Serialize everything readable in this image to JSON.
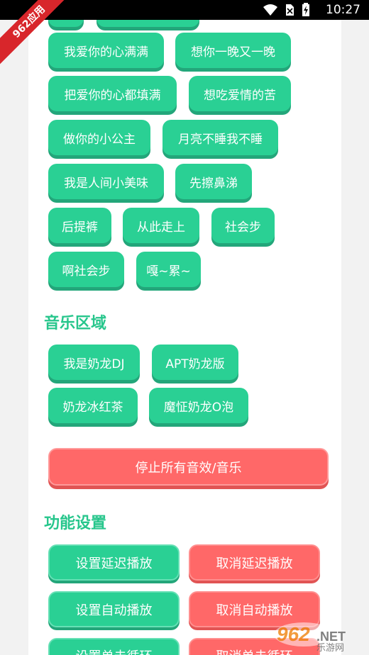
{
  "status": {
    "time": "10:27"
  },
  "badge": "962应用",
  "effect_buttons": [
    "我爱你的心满满",
    "想你一晚又一晚",
    "把爱你的心都填满",
    "想吃爱情的苦",
    "做你的小公主",
    "月亮不睡我不睡",
    "我是人间小美味",
    "先擦鼻涕",
    "后提裤",
    "从此走上",
    "社会步",
    "啊社会步",
    "嘎~累~"
  ],
  "music": {
    "title": "音乐区域",
    "buttons": [
      "我是奶龙DJ",
      "APT奶龙版",
      "奶龙冰红茶",
      "魔怔奶龙O泡"
    ]
  },
  "stop_button": "停止所有音效/音乐",
  "settings": {
    "title": "功能设置",
    "buttons": [
      "设置延迟播放",
      "取消延迟播放",
      "设置自动播放",
      "取消自动播放",
      "设置单击循环",
      "取消单击循环"
    ]
  },
  "watermark": {
    "number": "962",
    "suffix": ".NET",
    "sub": "乐游网"
  },
  "colors": {
    "accent": "#2ad094",
    "danger": "#ff6868",
    "title": "#27c68c"
  }
}
